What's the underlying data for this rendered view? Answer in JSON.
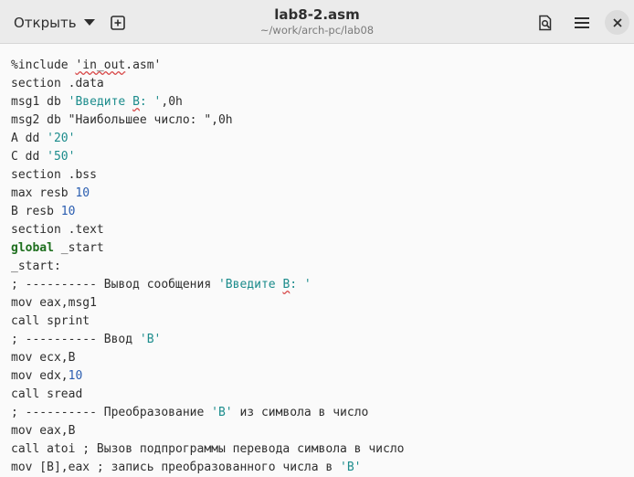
{
  "header": {
    "open_label": "Открыть",
    "title": "lab8-2.asm",
    "subtitle": "~/work/arch-pc/lab08",
    "icons": [
      "new-tab-icon",
      "document-search-icon",
      "hamburger-menu-icon",
      "close-icon"
    ]
  },
  "colors": {
    "string": "#1c8c8c",
    "number": "#2a5db0",
    "keyword": "#1e6f1e",
    "text": "#2e2e2e",
    "spell_error": "#d84a4a"
  },
  "editor": {
    "lines": [
      [
        {
          "t": "%include ",
          "c": ""
        },
        {
          "t": "'in_out",
          "c": "err"
        },
        {
          "t": ".asm'",
          "c": ""
        }
      ],
      [
        {
          "t": "section .data",
          "c": ""
        }
      ],
      [
        {
          "t": "msg1 db ",
          "c": ""
        },
        {
          "t": "'Введите ",
          "c": "str"
        },
        {
          "t": "B",
          "c": "str err"
        },
        {
          "t": ": '",
          "c": "str"
        },
        {
          "t": ",0h",
          "c": ""
        }
      ],
      [
        {
          "t": "msg2 db \"Наибольшее число: \",0h",
          "c": ""
        }
      ],
      [
        {
          "t": "A dd ",
          "c": ""
        },
        {
          "t": "'20'",
          "c": "str"
        }
      ],
      [
        {
          "t": "C dd ",
          "c": ""
        },
        {
          "t": "'50'",
          "c": "str"
        }
      ],
      [
        {
          "t": "section .bss",
          "c": ""
        }
      ],
      [
        {
          "t": "max resb ",
          "c": ""
        },
        {
          "t": "10",
          "c": "num"
        }
      ],
      [
        {
          "t": "B resb ",
          "c": ""
        },
        {
          "t": "10",
          "c": "num"
        }
      ],
      [
        {
          "t": "section .text",
          "c": ""
        }
      ],
      [
        {
          "t": "global",
          "c": "kw"
        },
        {
          "t": " _start",
          "c": ""
        }
      ],
      [
        {
          "t": "_start:",
          "c": ""
        }
      ],
      [
        {
          "t": "; ---------- Вывод сообщения ",
          "c": ""
        },
        {
          "t": "'Введите ",
          "c": "str"
        },
        {
          "t": "B",
          "c": "str err"
        },
        {
          "t": ": '",
          "c": "str"
        }
      ],
      [
        {
          "t": "mov eax,msg1",
          "c": ""
        }
      ],
      [
        {
          "t": "call sprint",
          "c": ""
        }
      ],
      [
        {
          "t": "; ---------- Ввод ",
          "c": ""
        },
        {
          "t": "'B'",
          "c": "str"
        }
      ],
      [
        {
          "t": "mov ecx,B",
          "c": ""
        }
      ],
      [
        {
          "t": "mov edx,",
          "c": ""
        },
        {
          "t": "10",
          "c": "num"
        }
      ],
      [
        {
          "t": "call sread",
          "c": ""
        }
      ],
      [
        {
          "t": "; ---------- Преобразование ",
          "c": ""
        },
        {
          "t": "'B'",
          "c": "str"
        },
        {
          "t": " из символа в число",
          "c": ""
        }
      ],
      [
        {
          "t": "mov eax,B",
          "c": ""
        }
      ],
      [
        {
          "t": "call atoi ; Вызов подпрограммы перевода символа в число",
          "c": ""
        }
      ],
      [
        {
          "t": "mov [B],eax ; запись преобразованного числа в ",
          "c": ""
        },
        {
          "t": "'B'",
          "c": "str"
        }
      ]
    ]
  }
}
